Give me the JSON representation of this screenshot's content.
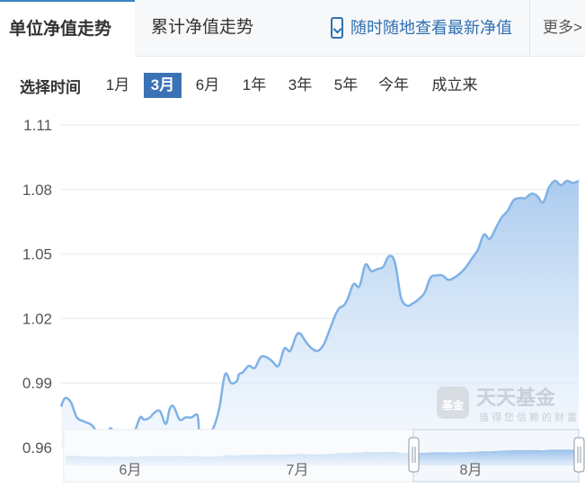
{
  "tabs": {
    "unit_nav": "单位净值走势",
    "cumulative_nav": "累计净值走势",
    "mobile_link": "随时随地查看最新净值",
    "more": "更多>"
  },
  "range_selector": {
    "label": "选择时间",
    "options": [
      "1月",
      "3月",
      "6月",
      "1年",
      "3年",
      "5年",
      "今年",
      "成立来"
    ],
    "selected": "3月"
  },
  "watermark": {
    "logo_text": "基金",
    "brand": "天天基金",
    "slogan": "值得您信赖的财富"
  },
  "colors": {
    "line": "#7fb2e5",
    "area_top": "#a7c9ee",
    "area_bottom": "#eef5fd",
    "selected_range": "#3b72b5"
  },
  "chart_data": {
    "type": "area",
    "title": "",
    "xlabel": "",
    "ylabel": "",
    "ylim": [
      0.96,
      1.11
    ],
    "yticks": [
      0.96,
      0.99,
      1.02,
      1.05,
      1.08,
      1.11
    ],
    "navigator_labels": [
      "6月",
      "7月",
      "8月"
    ],
    "grid": true,
    "x": [
      0,
      2,
      5,
      8,
      12,
      16,
      20,
      22,
      25,
      28,
      31,
      34,
      37,
      40,
      42,
      45,
      47,
      50,
      53,
      55,
      57,
      60,
      63,
      66,
      69,
      70,
      72,
      74,
      77,
      80,
      83,
      86,
      89,
      90,
      92,
      95,
      98,
      101,
      104,
      107,
      110,
      113,
      116,
      119,
      121,
      124,
      127,
      130,
      133,
      136,
      139,
      141,
      143,
      145,
      148,
      151,
      154,
      157,
      160,
      163,
      166,
      169,
      172,
      175,
      178,
      181,
      184,
      187,
      190,
      193,
      196,
      199,
      202,
      205,
      208,
      211,
      214,
      217,
      220,
      223,
      226,
      229,
      232,
      235,
      238,
      241,
      244,
      247,
      250,
      253,
      256,
      259,
      262
    ],
    "values": [
      0.979,
      0.983,
      0.981,
      0.974,
      0.972,
      0.97,
      0.964,
      0.963,
      0.969,
      0.964,
      0.964,
      0.965,
      0.967,
      0.974,
      0.973,
      0.974,
      0.976,
      0.977,
      0.971,
      0.978,
      0.979,
      0.973,
      0.974,
      0.974,
      0.975,
      0.967,
      0.966,
      0.966,
      0.969,
      0.978,
      0.994,
      0.99,
      0.991,
      0.994,
      0.995,
      0.998,
      0.997,
      1.002,
      1.002,
      1.0,
      0.998,
      1.006,
      1.005,
      1.012,
      1.013,
      1.009,
      1.006,
      1.005,
      1.008,
      1.015,
      1.022,
      1.025,
      1.026,
      1.029,
      1.036,
      1.035,
      1.045,
      1.042,
      1.043,
      1.044,
      1.049,
      1.046,
      1.03,
      1.026,
      1.027,
      1.029,
      1.032,
      1.039,
      1.04,
      1.04,
      1.038,
      1.039,
      1.041,
      1.044,
      1.048,
      1.052,
      1.059,
      1.057,
      1.062,
      1.067,
      1.07,
      1.075,
      1.076,
      1.076,
      1.078,
      1.077,
      1.074,
      1.081,
      1.084,
      1.082,
      1.084,
      1.083,
      1.084
    ]
  }
}
